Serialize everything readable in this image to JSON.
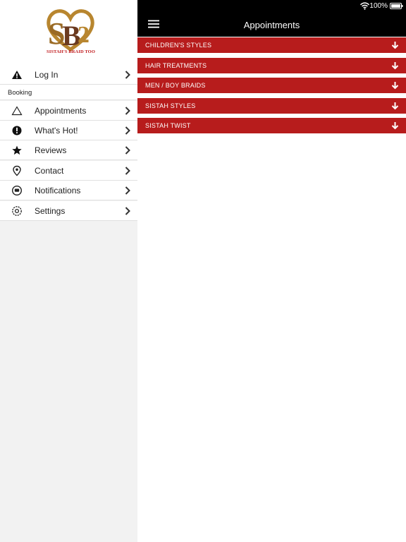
{
  "logo": {
    "caption": "SISTAH'S BRAID TOO"
  },
  "sidebar": {
    "login": {
      "label": "Log In"
    },
    "section_label": "Booking",
    "items": [
      {
        "label": "Appointments"
      },
      {
        "label": "What's Hot!"
      },
      {
        "label": "Reviews"
      },
      {
        "label": "Contact"
      },
      {
        "label": "Notifications"
      },
      {
        "label": "Settings"
      }
    ]
  },
  "status_bar": {
    "battery": "100%"
  },
  "header": {
    "title": "Appointments"
  },
  "categories": [
    {
      "label": "CHILDREN'S STYLES"
    },
    {
      "label": "HAIR TREATMENTS"
    },
    {
      "label": "MEN / BOY BRAIDS"
    },
    {
      "label": "SISTAH STYLES"
    },
    {
      "label": "SISTAH TWIST"
    }
  ],
  "colors": {
    "accent_red": "#b71c1c",
    "header_black": "#000000",
    "logo_gold": "#b8862f",
    "logo_brown": "#6b3a1f"
  }
}
